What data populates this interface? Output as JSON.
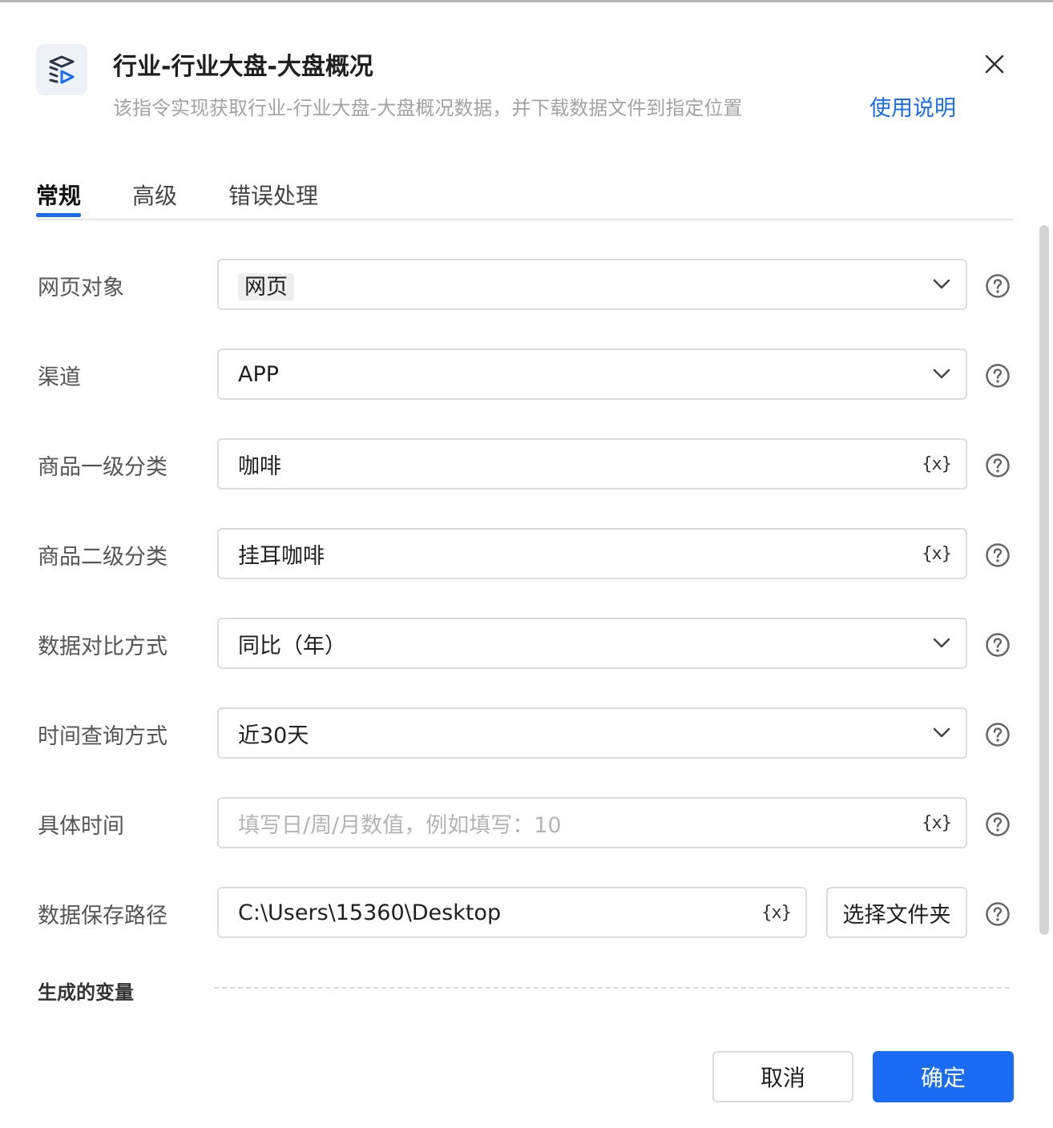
{
  "header": {
    "title": "行业-行业大盘-大盘概况",
    "subtitle": "该指令实现获取行业-行业大盘-大盘概况数据，并下载数据文件到指定位置",
    "help_link": "使用说明"
  },
  "tabs": [
    {
      "label": "常规",
      "active": true
    },
    {
      "label": "高级",
      "active": false
    },
    {
      "label": "错误处理",
      "active": false
    }
  ],
  "fields": {
    "web_object": {
      "label": "网页对象",
      "value": "网页"
    },
    "channel": {
      "label": "渠道",
      "value": "APP"
    },
    "category1": {
      "label": "商品一级分类",
      "value": "咖啡"
    },
    "category2": {
      "label": "商品二级分类",
      "value": "挂耳咖啡"
    },
    "compare_mode": {
      "label": "数据对比方式",
      "value": "同比（年）"
    },
    "time_query": {
      "label": "时间查询方式",
      "value": "近30天"
    },
    "specific_time": {
      "label": "具体时间",
      "value": "",
      "placeholder": "填写日/周/月数值，例如填写：10"
    },
    "save_path": {
      "label": "数据保存路径",
      "value": "C:\\Users\\15360\\Desktop"
    }
  },
  "variable_button": "{x}",
  "folder_button": "选择文件夹",
  "section_generated_vars": "生成的变量",
  "footer": {
    "cancel": "取消",
    "ok": "确定"
  },
  "colors": {
    "accent": "#1a6cf5"
  }
}
